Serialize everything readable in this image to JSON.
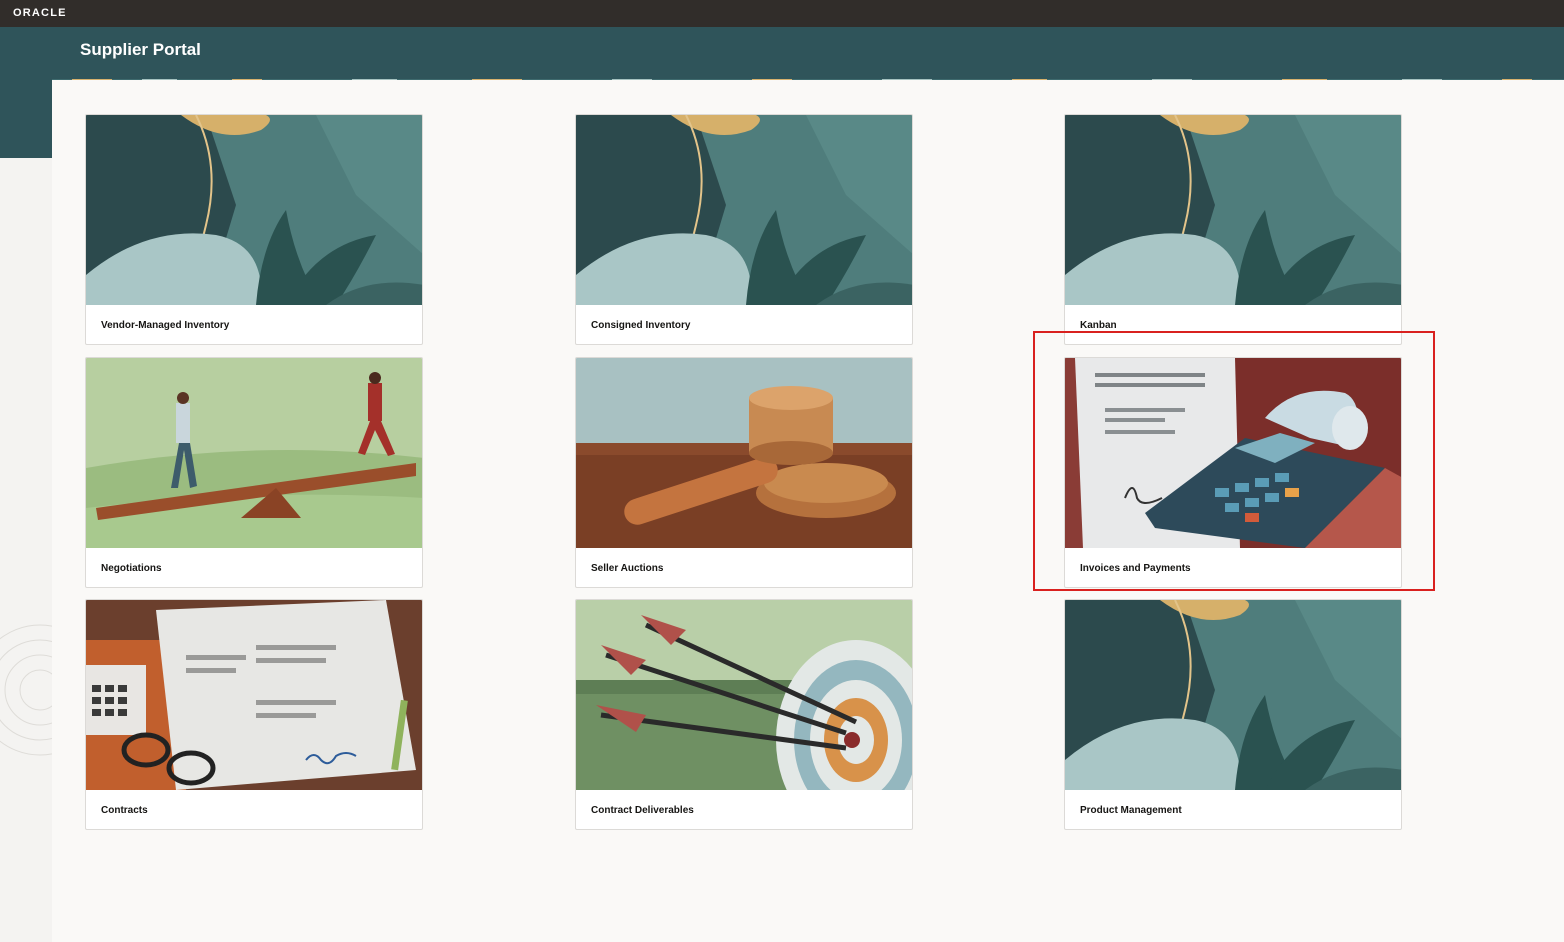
{
  "topbar": {
    "logo_text": "ORACLE"
  },
  "header": {
    "title": "Supplier Portal"
  },
  "tiles": [
    {
      "label": "Vendor-Managed Inventory",
      "image": "abstract-leaves-art"
    },
    {
      "label": "Consigned Inventory",
      "image": "abstract-leaves-art"
    },
    {
      "label": "Kanban",
      "image": "abstract-leaves-art"
    },
    {
      "label": "Negotiations",
      "image": "seesaw-people-art"
    },
    {
      "label": "Seller Auctions",
      "image": "gavel-art"
    },
    {
      "label": "Invoices and Payments",
      "image": "calculator-receipt-art"
    },
    {
      "label": "Contracts",
      "image": "contract-document-art"
    },
    {
      "label": "Contract Deliverables",
      "image": "arrows-target-art"
    },
    {
      "label": "Product Management",
      "image": "abstract-leaves-art"
    }
  ],
  "highlight": {
    "target": "Invoices and Payments",
    "color": "#d9211f"
  },
  "colors": {
    "topbar": "#312d2a",
    "header": "#2f545a",
    "panel": "#faf9f7"
  }
}
